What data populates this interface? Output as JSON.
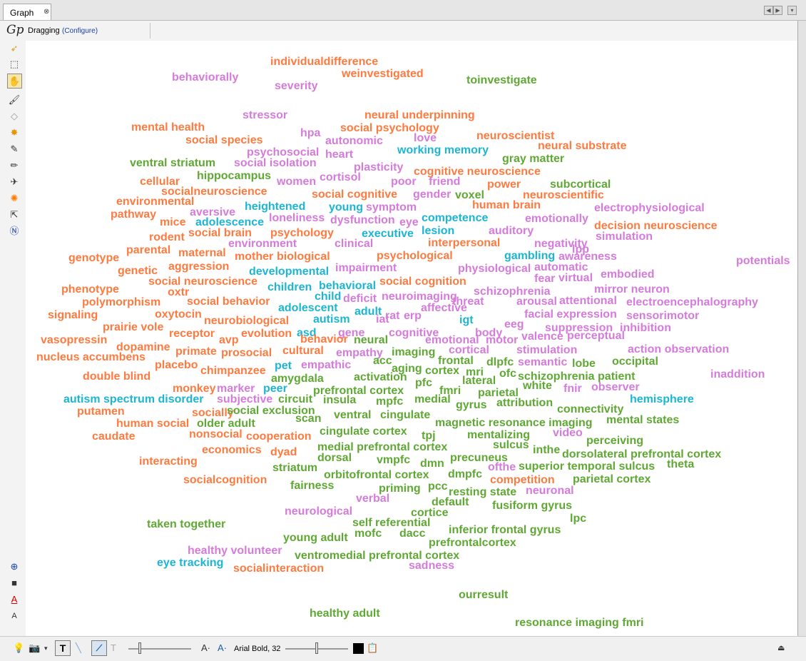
{
  "tab": {
    "label": "Graph",
    "close": "⊗"
  },
  "toolbar": {
    "mode_label": "Dragging",
    "configure_link": "(Configure)",
    "logo": "Gp"
  },
  "bottom": {
    "font_label": "Arial Bold, 32",
    "text_tool": "T",
    "font_size_dec": "A·",
    "font_size_inc": "A·"
  },
  "colors": {
    "orange": "#ff7a3f",
    "violet": "#d57bdb",
    "green": "#5fa834",
    "cyan": "#1cb6d3"
  },
  "words": [
    {
      "t": "individualdifference",
      "c": "orange"
    },
    {
      "t": "weinvestigated",
      "c": "orange"
    },
    {
      "t": "behaviorally",
      "c": "violet"
    },
    {
      "t": "severity",
      "c": "violet"
    },
    {
      "t": "toinvestigate",
      "c": "green"
    },
    {
      "t": "stressor",
      "c": "violet"
    },
    {
      "t": "neural underpinning",
      "c": "orange"
    },
    {
      "t": "mental health",
      "c": "orange"
    },
    {
      "t": "hpa",
      "c": "violet"
    },
    {
      "t": "social psychology",
      "c": "orange"
    },
    {
      "t": "social species",
      "c": "orange"
    },
    {
      "t": "autonomic",
      "c": "violet"
    },
    {
      "t": "love",
      "c": "violet"
    },
    {
      "t": "neuroscientist",
      "c": "orange"
    },
    {
      "t": "neural substrate",
      "c": "orange"
    },
    {
      "t": "psychosocial",
      "c": "violet"
    },
    {
      "t": "heart",
      "c": "violet"
    },
    {
      "t": "working memory",
      "c": "cyan"
    },
    {
      "t": "gray matter",
      "c": "green"
    },
    {
      "t": "ventral striatum",
      "c": "green"
    },
    {
      "t": "social isolation",
      "c": "violet"
    },
    {
      "t": "plasticity",
      "c": "violet"
    },
    {
      "t": "cognitive neuroscience",
      "c": "orange"
    },
    {
      "t": "hippocampus",
      "c": "green"
    },
    {
      "t": "cellular",
      "c": "orange"
    },
    {
      "t": "women",
      "c": "violet"
    },
    {
      "t": "cortisol",
      "c": "violet"
    },
    {
      "t": "poor",
      "c": "violet"
    },
    {
      "t": "friend",
      "c": "violet"
    },
    {
      "t": "power",
      "c": "orange"
    },
    {
      "t": "subcortical",
      "c": "green"
    },
    {
      "t": "socialneuroscience",
      "c": "orange"
    },
    {
      "t": "social cognitive",
      "c": "orange"
    },
    {
      "t": "gender",
      "c": "violet"
    },
    {
      "t": "voxel",
      "c": "green"
    },
    {
      "t": "neuroscientific",
      "c": "orange"
    },
    {
      "t": "environmental",
      "c": "orange"
    },
    {
      "t": "heightened",
      "c": "cyan"
    },
    {
      "t": "young",
      "c": "cyan"
    },
    {
      "t": "symptom",
      "c": "violet"
    },
    {
      "t": "human brain",
      "c": "orange"
    },
    {
      "t": "electrophysiological",
      "c": "violet"
    },
    {
      "t": "pathway",
      "c": "orange"
    },
    {
      "t": "aversive",
      "c": "violet"
    },
    {
      "t": "loneliness",
      "c": "violet"
    },
    {
      "t": "dysfunction",
      "c": "violet"
    },
    {
      "t": "eye",
      "c": "violet"
    },
    {
      "t": "competence",
      "c": "cyan"
    },
    {
      "t": "emotionally",
      "c": "violet"
    },
    {
      "t": "mice",
      "c": "orange"
    },
    {
      "t": "adolescence",
      "c": "cyan"
    },
    {
      "t": "decision neuroscience",
      "c": "orange"
    },
    {
      "t": "social brain",
      "c": "orange"
    },
    {
      "t": "psychology",
      "c": "orange"
    },
    {
      "t": "executive",
      "c": "cyan"
    },
    {
      "t": "lesion",
      "c": "cyan"
    },
    {
      "t": "auditory",
      "c": "violet"
    },
    {
      "t": "rodent",
      "c": "orange"
    },
    {
      "t": "simulation",
      "c": "violet"
    },
    {
      "t": "environment",
      "c": "violet"
    },
    {
      "t": "clinical",
      "c": "violet"
    },
    {
      "t": "interpersonal",
      "c": "orange"
    },
    {
      "t": "negativity",
      "c": "violet"
    },
    {
      "t": "lpp",
      "c": "violet"
    },
    {
      "t": "parental",
      "c": "orange"
    },
    {
      "t": "maternal",
      "c": "orange"
    },
    {
      "t": "genotype",
      "c": "orange"
    },
    {
      "t": "mother",
      "c": "orange"
    },
    {
      "t": "biological",
      "c": "orange"
    },
    {
      "t": "psychological",
      "c": "orange"
    },
    {
      "t": "gambling",
      "c": "cyan"
    },
    {
      "t": "awareness",
      "c": "violet"
    },
    {
      "t": "potentials",
      "c": "violet"
    },
    {
      "t": "aggression",
      "c": "orange"
    },
    {
      "t": "impairment",
      "c": "violet"
    },
    {
      "t": "automatic",
      "c": "violet"
    },
    {
      "t": "genetic",
      "c": "orange"
    },
    {
      "t": "developmental",
      "c": "cyan"
    },
    {
      "t": "physiological",
      "c": "violet"
    },
    {
      "t": "embodied",
      "c": "violet"
    },
    {
      "t": "social neuroscience",
      "c": "orange"
    },
    {
      "t": "social cognition",
      "c": "orange"
    },
    {
      "t": "fear",
      "c": "violet"
    },
    {
      "t": "virtual",
      "c": "violet"
    },
    {
      "t": "phenotype",
      "c": "orange"
    },
    {
      "t": "oxtr",
      "c": "orange"
    },
    {
      "t": "children",
      "c": "cyan"
    },
    {
      "t": "behavioral",
      "c": "cyan"
    },
    {
      "t": "schizophrenia",
      "c": "violet"
    },
    {
      "t": "mirror neuron",
      "c": "violet"
    },
    {
      "t": "polymorphism",
      "c": "orange"
    },
    {
      "t": "social behavior",
      "c": "orange"
    },
    {
      "t": "child",
      "c": "cyan"
    },
    {
      "t": "deficit",
      "c": "violet"
    },
    {
      "t": "neuroimaging",
      "c": "violet"
    },
    {
      "t": "threat",
      "c": "violet"
    },
    {
      "t": "arousal",
      "c": "violet"
    },
    {
      "t": "attentional",
      "c": "violet"
    },
    {
      "t": "electroencephalography",
      "c": "violet"
    },
    {
      "t": "adolescent",
      "c": "cyan"
    },
    {
      "t": "affective",
      "c": "violet"
    },
    {
      "t": "signaling",
      "c": "orange"
    },
    {
      "t": "oxytocin",
      "c": "orange"
    },
    {
      "t": "adult",
      "c": "cyan"
    },
    {
      "t": "rat",
      "c": "violet"
    },
    {
      "t": "erp",
      "c": "violet"
    },
    {
      "t": "facial expression",
      "c": "violet"
    },
    {
      "t": "sensorimotor",
      "c": "violet"
    },
    {
      "t": "neurobiological",
      "c": "orange"
    },
    {
      "t": "autism",
      "c": "cyan"
    },
    {
      "t": "iat",
      "c": "violet"
    },
    {
      "t": "igt",
      "c": "cyan"
    },
    {
      "t": "eeg",
      "c": "violet"
    },
    {
      "t": "prairie vole",
      "c": "orange"
    },
    {
      "t": "asd",
      "c": "cyan"
    },
    {
      "t": "gene",
      "c": "violet"
    },
    {
      "t": "cognitive",
      "c": "violet"
    },
    {
      "t": "body",
      "c": "violet"
    },
    {
      "t": "suppression",
      "c": "violet"
    },
    {
      "t": "inhibition",
      "c": "violet"
    },
    {
      "t": "receptor",
      "c": "orange"
    },
    {
      "t": "evolution",
      "c": "orange"
    },
    {
      "t": "vasopressin",
      "c": "orange"
    },
    {
      "t": "avp",
      "c": "orange"
    },
    {
      "t": "behavior",
      "c": "orange"
    },
    {
      "t": "neural",
      "c": "green"
    },
    {
      "t": "emotional",
      "c": "violet"
    },
    {
      "t": "motor",
      "c": "violet"
    },
    {
      "t": "valence",
      "c": "violet"
    },
    {
      "t": "perceptual",
      "c": "violet"
    },
    {
      "t": "dopamine",
      "c": "orange"
    },
    {
      "t": "cultural",
      "c": "orange"
    },
    {
      "t": "cortical",
      "c": "violet"
    },
    {
      "t": "stimulation",
      "c": "violet"
    },
    {
      "t": "action observation",
      "c": "violet"
    },
    {
      "t": "primate",
      "c": "orange"
    },
    {
      "t": "prosocial",
      "c": "orange"
    },
    {
      "t": "empathy",
      "c": "violet"
    },
    {
      "t": "imaging",
      "c": "green"
    },
    {
      "t": "nucleus accumbens",
      "c": "orange"
    },
    {
      "t": "frontal",
      "c": "green"
    },
    {
      "t": "dlpfc",
      "c": "green"
    },
    {
      "t": "semantic",
      "c": "violet"
    },
    {
      "t": "lobe",
      "c": "green"
    },
    {
      "t": "occipital",
      "c": "green"
    },
    {
      "t": "placebo",
      "c": "orange"
    },
    {
      "t": "pet",
      "c": "cyan"
    },
    {
      "t": "empathic",
      "c": "violet"
    },
    {
      "t": "acc",
      "c": "green"
    },
    {
      "t": "aging",
      "c": "green"
    },
    {
      "t": "chimpanzee",
      "c": "orange"
    },
    {
      "t": "cortex",
      "c": "green"
    },
    {
      "t": "mri",
      "c": "green"
    },
    {
      "t": "ofc",
      "c": "green"
    },
    {
      "t": "inaddition",
      "c": "violet"
    },
    {
      "t": "double blind",
      "c": "orange"
    },
    {
      "t": "amygdala",
      "c": "green"
    },
    {
      "t": "activation",
      "c": "green"
    },
    {
      "t": "lateral",
      "c": "green"
    },
    {
      "t": "schizophrenia patient",
      "c": "green"
    },
    {
      "t": "pfc",
      "c": "green"
    },
    {
      "t": "white",
      "c": "green"
    },
    {
      "t": "monkey",
      "c": "orange"
    },
    {
      "t": "marker",
      "c": "violet"
    },
    {
      "t": "peer",
      "c": "cyan"
    },
    {
      "t": "prefrontal cortex",
      "c": "green"
    },
    {
      "t": "fmri",
      "c": "green"
    },
    {
      "t": "fnir",
      "c": "violet"
    },
    {
      "t": "observer",
      "c": "violet"
    },
    {
      "t": "parietal",
      "c": "green"
    },
    {
      "t": "autism spectrum disorder",
      "c": "cyan"
    },
    {
      "t": "subjective",
      "c": "violet"
    },
    {
      "t": "circuit",
      "c": "green"
    },
    {
      "t": "insula",
      "c": "green"
    },
    {
      "t": "mpfc",
      "c": "green"
    },
    {
      "t": "medial",
      "c": "green"
    },
    {
      "t": "attribution",
      "c": "green"
    },
    {
      "t": "hemisphere",
      "c": "cyan"
    },
    {
      "t": "putamen",
      "c": "orange"
    },
    {
      "t": "socially",
      "c": "orange"
    },
    {
      "t": "social exclusion",
      "c": "green"
    },
    {
      "t": "gyrus",
      "c": "green"
    },
    {
      "t": "connectivity",
      "c": "green"
    },
    {
      "t": "scan",
      "c": "green"
    },
    {
      "t": "ventral",
      "c": "green"
    },
    {
      "t": "cingulate",
      "c": "green"
    },
    {
      "t": "human social",
      "c": "orange"
    },
    {
      "t": "older adult",
      "c": "green"
    },
    {
      "t": "magnetic resonance imaging",
      "c": "green"
    },
    {
      "t": "mental states",
      "c": "green"
    },
    {
      "t": "caudate",
      "c": "orange"
    },
    {
      "t": "nonsocial",
      "c": "orange"
    },
    {
      "t": "cooperation",
      "c": "orange"
    },
    {
      "t": "cingulate cortex",
      "c": "green"
    },
    {
      "t": "tpj",
      "c": "green"
    },
    {
      "t": "mentalizing",
      "c": "green"
    },
    {
      "t": "video",
      "c": "violet"
    },
    {
      "t": "perceiving",
      "c": "green"
    },
    {
      "t": "sulcus",
      "c": "green"
    },
    {
      "t": "economics",
      "c": "orange"
    },
    {
      "t": "dyad",
      "c": "orange"
    },
    {
      "t": "medial prefrontal cortex",
      "c": "green"
    },
    {
      "t": "inthe",
      "c": "green"
    },
    {
      "t": "dorsolateral prefrontal cortex",
      "c": "green"
    },
    {
      "t": "interacting",
      "c": "orange"
    },
    {
      "t": "dorsal",
      "c": "green"
    },
    {
      "t": "vmpfc",
      "c": "green"
    },
    {
      "t": "dmn",
      "c": "green"
    },
    {
      "t": "precuneus",
      "c": "green"
    },
    {
      "t": "ofthe",
      "c": "violet"
    },
    {
      "t": "superior temporal sulcus",
      "c": "green"
    },
    {
      "t": "theta",
      "c": "green"
    },
    {
      "t": "striatum",
      "c": "green"
    },
    {
      "t": "dmpfc",
      "c": "green"
    },
    {
      "t": "socialcognition",
      "c": "orange"
    },
    {
      "t": "orbitofrontal cortex",
      "c": "green"
    },
    {
      "t": "competition",
      "c": "orange"
    },
    {
      "t": "parietal cortex",
      "c": "green"
    },
    {
      "t": "fairness",
      "c": "green"
    },
    {
      "t": "priming",
      "c": "green"
    },
    {
      "t": "pcc",
      "c": "green"
    },
    {
      "t": "resting state",
      "c": "green"
    },
    {
      "t": "neuronal",
      "c": "violet"
    },
    {
      "t": "verbal",
      "c": "violet"
    },
    {
      "t": "default",
      "c": "green"
    },
    {
      "t": "fusiform gyrus",
      "c": "green"
    },
    {
      "t": "neurological",
      "c": "violet"
    },
    {
      "t": "cortice",
      "c": "green"
    },
    {
      "t": "lpc",
      "c": "green"
    },
    {
      "t": "taken together",
      "c": "green"
    },
    {
      "t": "self referential",
      "c": "green"
    },
    {
      "t": "inferior frontal gyrus",
      "c": "green"
    },
    {
      "t": "young adult",
      "c": "green"
    },
    {
      "t": "mofc",
      "c": "green"
    },
    {
      "t": "dacc",
      "c": "green"
    },
    {
      "t": "prefrontalcortex",
      "c": "green"
    },
    {
      "t": "healthy volunteer",
      "c": "violet"
    },
    {
      "t": "ventromedial prefrontal cortex",
      "c": "green"
    },
    {
      "t": "eye tracking",
      "c": "cyan"
    },
    {
      "t": "socialinteraction",
      "c": "orange"
    },
    {
      "t": "sadness",
      "c": "violet"
    },
    {
      "t": "ourresult",
      "c": "green"
    },
    {
      "t": "healthy adult",
      "c": "green"
    },
    {
      "t": "resonance imaging fmri",
      "c": "green"
    }
  ]
}
